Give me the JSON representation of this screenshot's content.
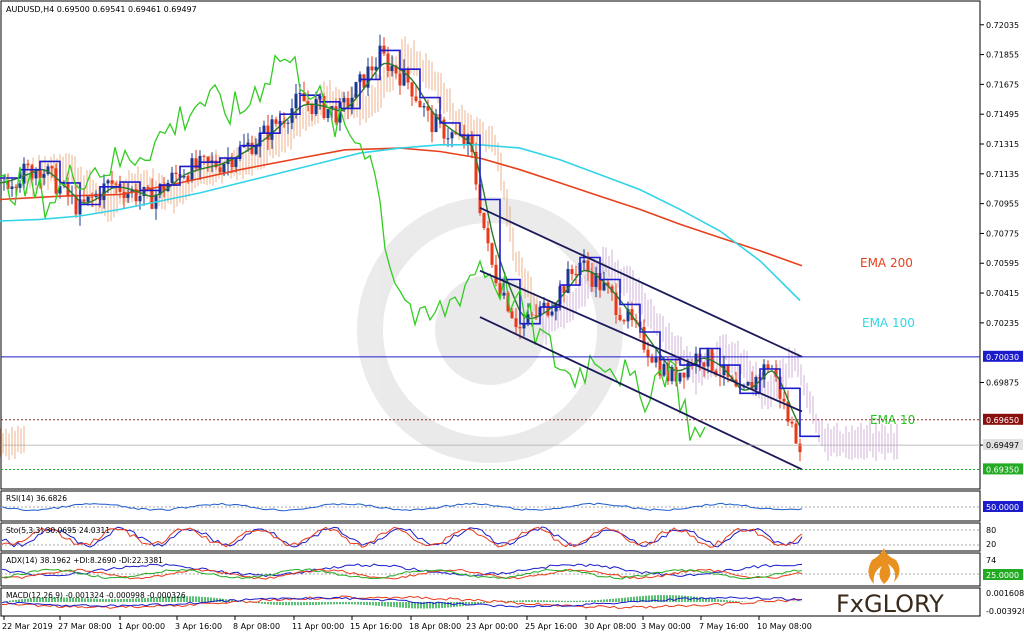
{
  "chart_data": {
    "type": "candlestick",
    "symbol_header": "AUDUSD,H4  0.69500 0.69541 0.69461 0.69497",
    "ylim": [
      0.6925,
      0.721
    ],
    "y_ticks": [
      "0.72035",
      "0.71855",
      "0.71675",
      "0.71495",
      "0.71315",
      "0.71135",
      "0.70955",
      "0.70775",
      "0.70595",
      "0.70415",
      "0.70235",
      "0.69875",
      "0.69497"
    ],
    "x_ticks": [
      "22 Mar 2019",
      "27 Mar 08:00",
      "1 Apr 00:00",
      "3 Apr 16:00",
      "8 Apr 08:00",
      "11 Apr 00:00",
      "15 Apr 16:00",
      "18 Apr 08:00",
      "23 Apr 00:00",
      "25 Apr 16:00",
      "30 Apr 08:00",
      "3 May 00:00",
      "7 May 16:00",
      "10 May 08:00"
    ],
    "level_labels": {
      "resistance": "0.70030",
      "dotted_red": "0.69650",
      "current": "0.69497",
      "support": "0.69350"
    },
    "series_labels": [
      {
        "text": "EMA 200",
        "color": "#e8401c"
      },
      {
        "text": "EMA 100",
        "color": "#33d4e8"
      },
      {
        "text": "EMA 10",
        "color": "#22c822"
      }
    ],
    "colors": {
      "bull": "#1a3a8f",
      "bear": "#e83a1a",
      "ema200": "#e8401c",
      "ema100": "#33d4e8",
      "ema10": "#22c822",
      "kijun": "#1c1ccc",
      "cloud_up": "#e8a070",
      "cloud_down": "#c8a0d0",
      "channel": "#1a1a5a",
      "chikou": "#33cc22"
    },
    "ema200": [
      [
        0,
        0.7098
      ],
      [
        60,
        0.71
      ],
      [
        120,
        0.7101
      ],
      [
        180,
        0.7108
      ],
      [
        240,
        0.7116
      ],
      [
        300,
        0.7123
      ],
      [
        345,
        0.7128
      ],
      [
        400,
        0.7129
      ],
      [
        440,
        0.7127
      ],
      [
        480,
        0.7123
      ],
      [
        520,
        0.7116
      ],
      [
        560,
        0.7108
      ],
      [
        600,
        0.71
      ],
      [
        640,
        0.7092
      ],
      [
        680,
        0.7083
      ],
      [
        720,
        0.7075
      ],
      [
        760,
        0.7067
      ],
      [
        802,
        0.7058
      ]
    ],
    "ema100": [
      [
        0,
        0.7085
      ],
      [
        40,
        0.7086
      ],
      [
        80,
        0.7088
      ],
      [
        120,
        0.7092
      ],
      [
        160,
        0.7097
      ],
      [
        200,
        0.7102
      ],
      [
        240,
        0.7108
      ],
      [
        280,
        0.7114
      ],
      [
        320,
        0.712
      ],
      [
        360,
        0.7126
      ],
      [
        400,
        0.7129
      ],
      [
        440,
        0.7131
      ],
      [
        480,
        0.7131
      ],
      [
        520,
        0.7129
      ],
      [
        560,
        0.7122
      ],
      [
        600,
        0.7113
      ],
      [
        640,
        0.7104
      ],
      [
        680,
        0.7092
      ],
      [
        720,
        0.7079
      ],
      [
        760,
        0.7061
      ],
      [
        800,
        0.7037
      ]
    ],
    "resistance": 0.7003,
    "dotted_red": 0.6965,
    "support": 0.6935,
    "current": 0.69497,
    "channel_top": [
      [
        480,
        0.7093
      ],
      [
        802,
        0.7003
      ]
    ],
    "channel_mid": [
      [
        480,
        0.7055
      ],
      [
        802,
        0.697
      ]
    ],
    "channel_bot": [
      [
        480,
        0.7027
      ],
      [
        802,
        0.6935
      ]
    ],
    "rsi_label": "RSI(14) 36.6826",
    "rsi_level": "50.0000",
    "sto_label": "Sto(5,3,3) 30.0695 24.0311",
    "sto_levels": [
      "80",
      "20"
    ],
    "adx_label": "ADX(14) 38.1962 +DI:8.2690 -DI:22.3381",
    "adx_levels": [
      "74",
      "25.0000"
    ],
    "macd_label": "MACD(12,26,9) -0.001324 -0.000998 -0.000326",
    "macd_levels": [
      "0.001608",
      "-0.003928"
    ],
    "logo": "FxGLORY"
  }
}
